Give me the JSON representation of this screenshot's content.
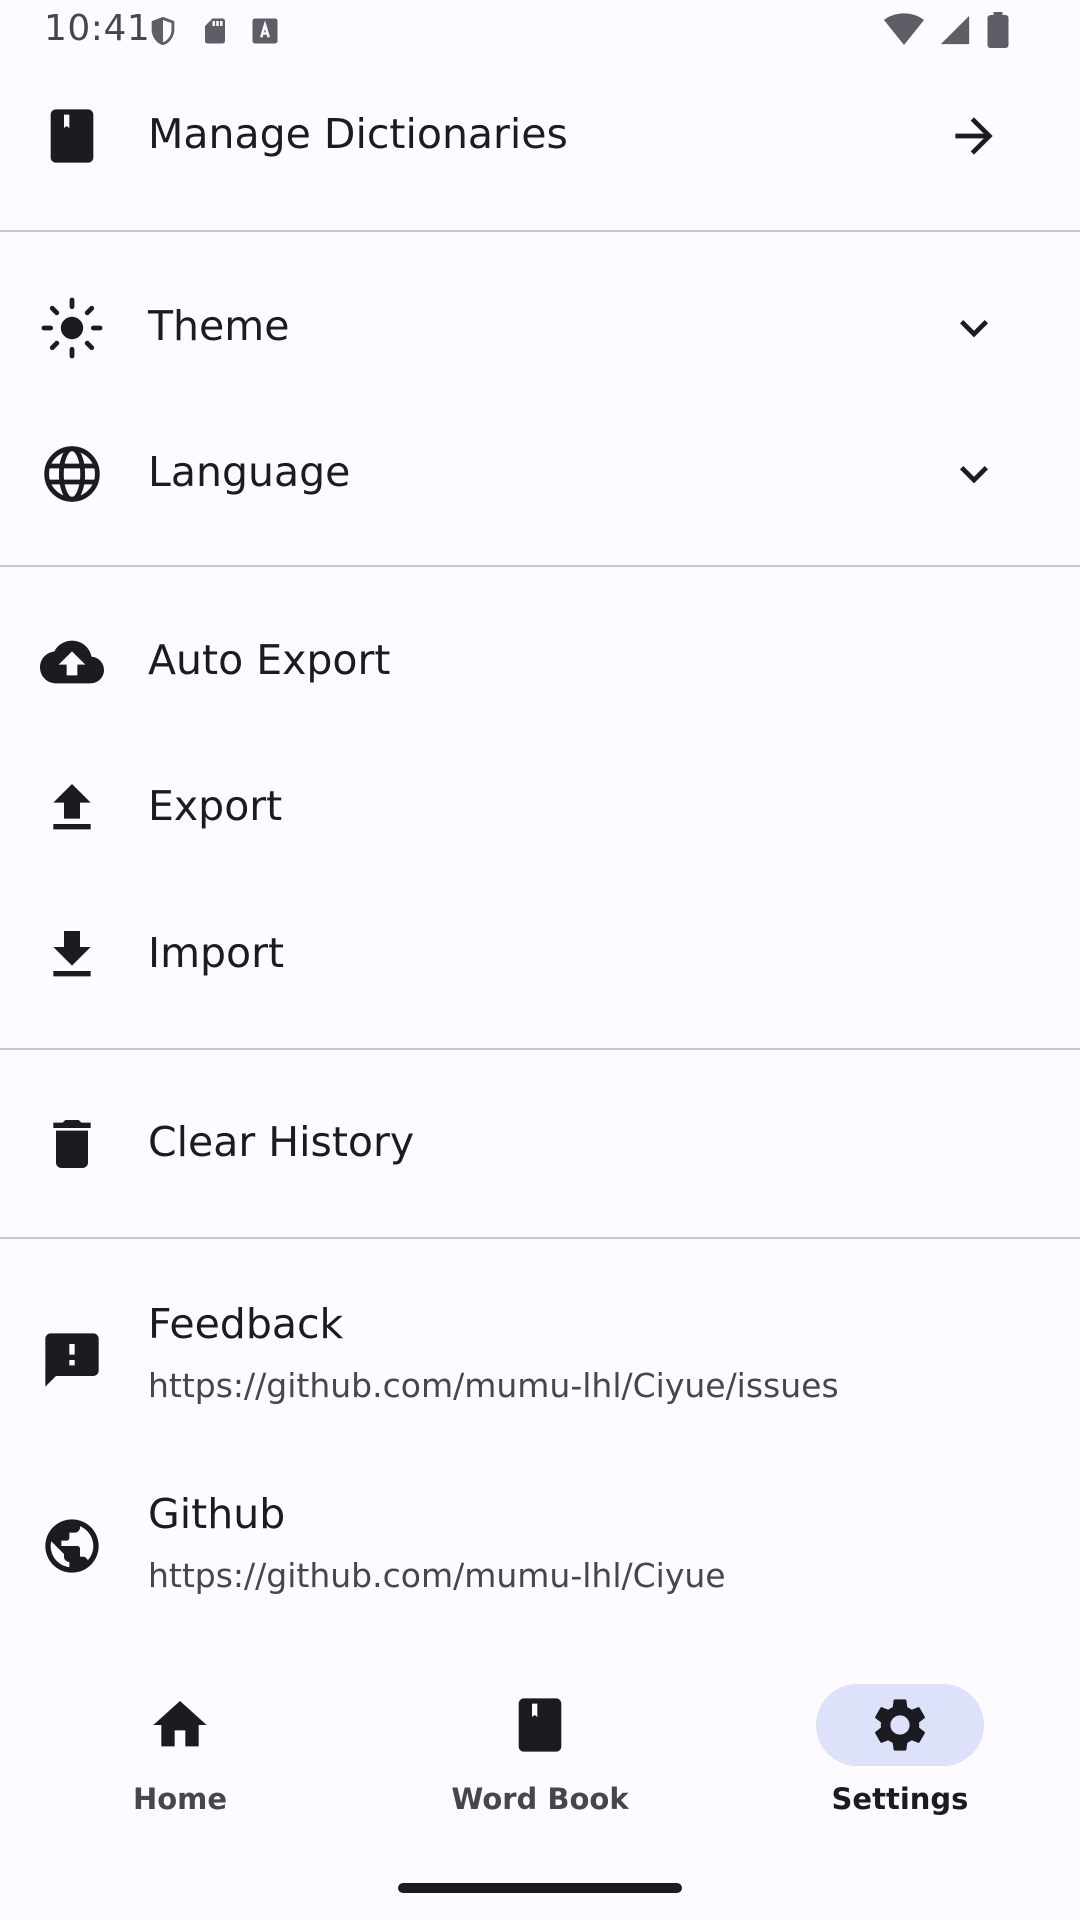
{
  "status_bar": {
    "time": "10:41",
    "left_icons": [
      "shield-icon",
      "sd-card-icon",
      "text-a-icon"
    ],
    "right_icons": [
      "wifi-icon",
      "signal-icon",
      "battery-icon"
    ]
  },
  "settings": {
    "manage_dictionaries": {
      "label": "Manage Dictionaries",
      "icon": "book-icon",
      "trailing": "arrow-right-icon"
    },
    "theme": {
      "label": "Theme",
      "icon": "sun-icon",
      "trailing": "chevron-down-icon"
    },
    "language": {
      "label": "Language",
      "icon": "globe-icon",
      "trailing": "chevron-down-icon"
    },
    "auto_export": {
      "label": "Auto Export",
      "icon": "cloud-upload-icon"
    },
    "export": {
      "label": "Export",
      "icon": "upload-icon"
    },
    "import": {
      "label": "Import",
      "icon": "download-icon"
    },
    "clear_history": {
      "label": "Clear History",
      "icon": "trash-icon"
    },
    "feedback": {
      "label": "Feedback",
      "url": "https://github.com/mumu-lhl/Ciyue/issues",
      "icon": "feedback-icon"
    },
    "github": {
      "label": "Github",
      "url": "https://github.com/mumu-lhl/Ciyue",
      "icon": "public-globe-icon"
    }
  },
  "bottom_nav": {
    "items": [
      {
        "label": "Home",
        "icon": "home-icon",
        "active": false
      },
      {
        "label": "Word Book",
        "icon": "book-icon",
        "active": false
      },
      {
        "label": "Settings",
        "icon": "gear-icon",
        "active": true
      }
    ]
  },
  "colors": {
    "background": "#fdfbff",
    "text_primary": "#1b1b21",
    "text_secondary": "#47464f",
    "divider": "#c9c6d0",
    "active_indicator": "#dde1f9"
  }
}
